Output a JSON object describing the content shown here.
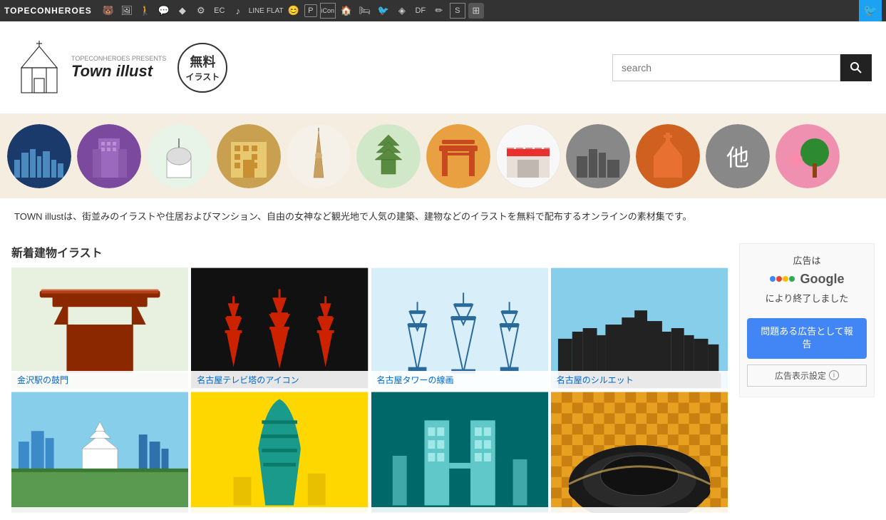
{
  "topnav": {
    "brand": "TOPECONHEROES",
    "icons": [
      "🐻",
      "🖼",
      "🚶",
      "💬",
      "🔶",
      "⚙",
      "EC",
      "♪",
      "LINE",
      "FLAT",
      "😊",
      "P",
      "iCon",
      "🏠",
      "🛏",
      "🐦",
      "🔶",
      "DF",
      "✏",
      "S"
    ],
    "twitter_label": "🐦"
  },
  "header": {
    "logo_presents": "TOPECONHEROES PRESENTS",
    "logo_title": "Town illust",
    "logo_badge_line1": "無料",
    "logo_badge_line2": "イラスト",
    "search_placeholder": "search"
  },
  "categories": [
    {
      "id": "cityscape",
      "color": "#1a3a6b",
      "label": "都市景観"
    },
    {
      "id": "building-purple",
      "color": "#7b4a9e",
      "label": "ビル"
    },
    {
      "id": "shrine",
      "color": "#ffffff",
      "label": "神社"
    },
    {
      "id": "hotel",
      "color": "#c8a050",
      "label": "ホテル"
    },
    {
      "id": "tower",
      "color": "#f5f0e8",
      "label": "タワー"
    },
    {
      "id": "temple",
      "color": "#e8f0e0",
      "label": "寺"
    },
    {
      "id": "torii",
      "color": "#e8a040",
      "label": "鳥居"
    },
    {
      "id": "shop",
      "color": "#f8f8f8",
      "label": "店"
    },
    {
      "id": "building2",
      "color": "#606060",
      "label": "建物2"
    },
    {
      "id": "church",
      "color": "#d06020",
      "label": "教会"
    },
    {
      "id": "other",
      "color": "#888888",
      "label": "他"
    },
    {
      "id": "nature",
      "color": "#f090b0",
      "label": "自然"
    }
  ],
  "description": "TOWN illustは、街並みのイラストや住居およびマンション、自由の女神など観光地で人気の建築、建物などのイラストを無料で配布するオンラインの素材集です。",
  "section_title": "新着建物イラスト",
  "grid_items": [
    {
      "id": "kanazawa",
      "caption": "金沢駅の鼓門"
    },
    {
      "id": "nagoya-icon",
      "caption": "名古屋テレビ塔のアイコン"
    },
    {
      "id": "nagoya-tower",
      "caption": "名古屋タワーの線画"
    },
    {
      "id": "nagoya-silhouette",
      "caption": "名古屋のシルエット"
    },
    {
      "id": "city1",
      "caption": ""
    },
    {
      "id": "city2",
      "caption": ""
    },
    {
      "id": "city3",
      "caption": ""
    },
    {
      "id": "city4",
      "caption": ""
    }
  ],
  "sidebar": {
    "ad_title_line1": "広告は",
    "ad_title_google": "Google",
    "ad_title_line2": "により終了しました",
    "report_btn": "問題ある広告として報告",
    "settings_label": "広告表示設定"
  }
}
